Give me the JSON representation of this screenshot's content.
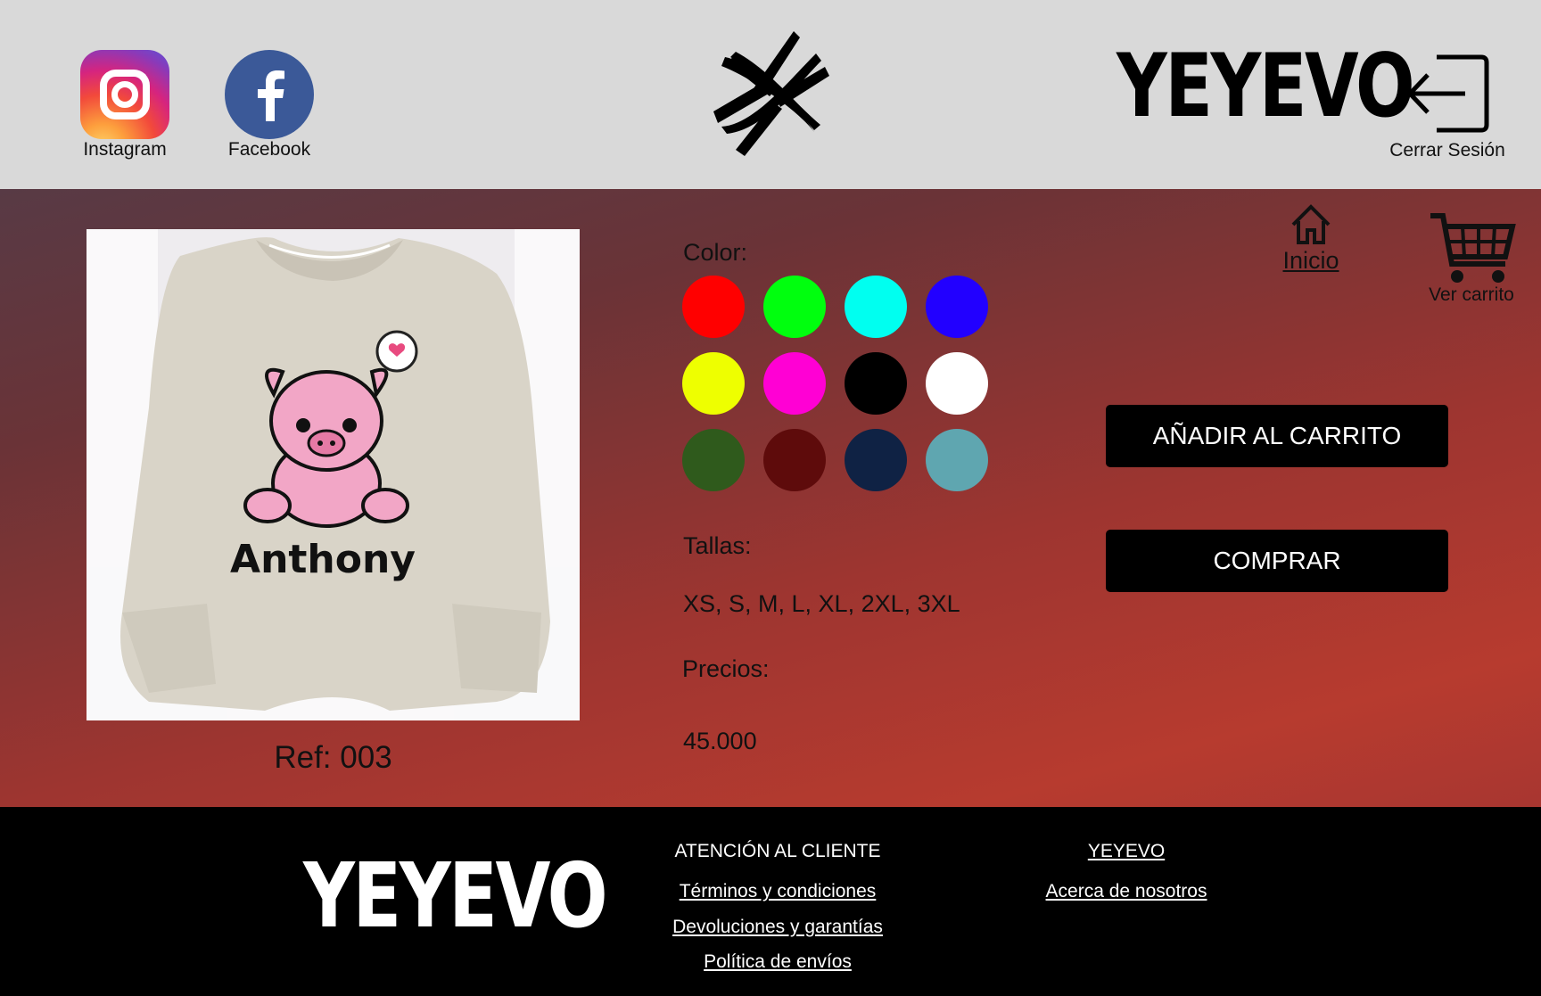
{
  "header": {
    "social": [
      {
        "label": "Instagram",
        "icon": "instagram-icon"
      },
      {
        "label": "Facebook",
        "icon": "facebook-icon"
      }
    ],
    "brand": "YEYEVO",
    "logout_label": "Cerrar Sesión"
  },
  "nav": {
    "home_label": "Inicio",
    "cart_label": "Ver carrito"
  },
  "product": {
    "image_text": "Anthony",
    "ref": "Ref: 003",
    "color_title": "Color:",
    "colors": [
      "#ff0000",
      "#00ff0e",
      "#00fff0",
      "#2200ff",
      "#eeff00",
      "#ff00d4",
      "#000000",
      "#ffffff",
      "#2f5a1c",
      "#5e0b0b",
      "#0f2244",
      "#5fa6b0"
    ],
    "sizes_title": "Tallas:",
    "sizes": "XS, S, M, L, XL, 2XL, 3XL",
    "prices_title": "Precios:",
    "price": "45.000"
  },
  "actions": {
    "add_to_cart": "AÑADIR AL CARRITO",
    "buy": "COMPRAR"
  },
  "footer": {
    "brand": "YEYEVO",
    "customer_title": "ATENCIÓN AL CLIENTE",
    "customer_links": [
      "Términos y condiciones",
      "Devoluciones y garantías",
      "Política de envíos"
    ],
    "company_title": "YEYEVO",
    "company_links": [
      "Acerca de nosotros"
    ]
  }
}
